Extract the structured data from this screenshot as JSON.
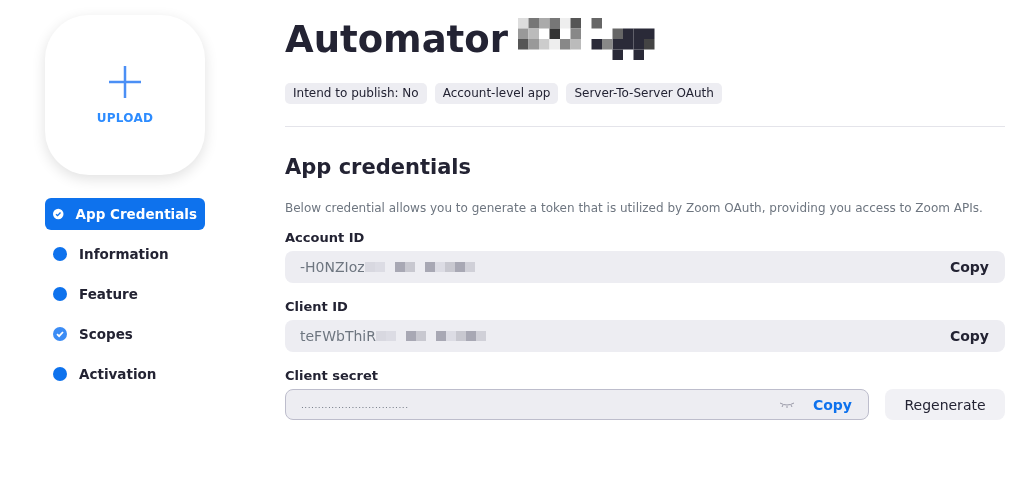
{
  "upload": {
    "label": "UPLOAD"
  },
  "nav": [
    {
      "label": "App Credentials",
      "selected": true,
      "completed": true
    },
    {
      "label": "Information",
      "selected": false,
      "completed": false
    },
    {
      "label": "Feature",
      "selected": false,
      "completed": false
    },
    {
      "label": "Scopes",
      "selected": false,
      "completed": true
    },
    {
      "label": "Activation",
      "selected": false,
      "completed": false
    }
  ],
  "app": {
    "title": "Automator",
    "tags": [
      "Intend to publish: No",
      "Account-level app",
      "Server-To-Server OAuth"
    ]
  },
  "section": {
    "heading": "App credentials",
    "description": "Below credential allows you to generate a token that is utilized by Zoom OAuth, providing you access to Zoom APIs."
  },
  "fields": [
    {
      "kind": "plain",
      "label": "Account ID",
      "value": "-H0NZIoz",
      "copy": "Copy"
    },
    {
      "kind": "plain",
      "label": "Client ID",
      "value": "teFWbThiR",
      "copy": "Copy"
    },
    {
      "kind": "secret",
      "label": "Client secret",
      "value": "................................",
      "copy": "Copy",
      "action": "Regenerate"
    }
  ]
}
